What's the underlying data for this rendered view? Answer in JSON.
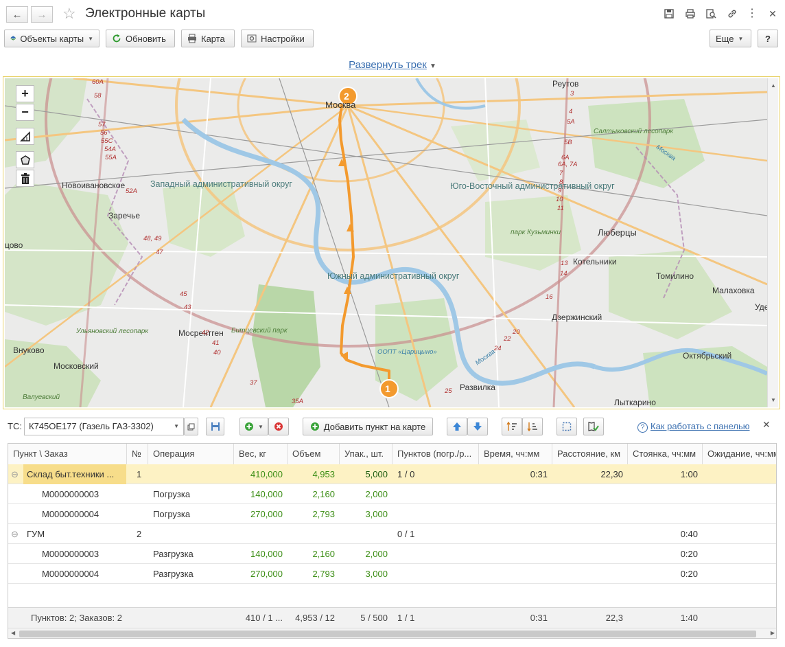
{
  "window": {
    "title": "Электронные карты",
    "back_icon": "←",
    "forward_icon": "→"
  },
  "toolbar": {
    "map_objects": "Объекты карты",
    "refresh": "Обновить",
    "map": "Карта",
    "settings": "Настройки",
    "more": "Еще",
    "help": "?"
  },
  "expand_track": "Развернуть трек",
  "map": {
    "zoom_in": "+",
    "zoom_out": "−",
    "markers": [
      "1",
      "2"
    ],
    "labels": {
      "moskva": "Москва",
      "reutov": "Реутов",
      "novoivanovskoe": "Новоивановское",
      "zarechye": "Заречье",
      "zapadny": "Западный административный округ",
      "yugo_vostochny": "Юго-Восточный административный округ",
      "yuzhny": "Южный административный округ",
      "lyubertsy": "Люберцы",
      "kotelniki": "Котельники",
      "tomilino": "Томилино",
      "malakhovka": "Малаховка",
      "dzerzhinsky": "Дзержинский",
      "mosrentgen": "Мосрентген",
      "vnukovo": "Внуково",
      "moskovsky": "Московский",
      "razvilka": "Развилка",
      "oktyabrsky": "Октябрьский",
      "lytkarino": "Лыткарино",
      "valuevsky": "Валуевский",
      "tsovo": "цово",
      "ude": "Уде",
      "saltykovsky": "Салтыковский лесопарк",
      "bitsevsky": "Битцевский парк",
      "kuzminki": "парк Кузьминки",
      "tsaritsyno": "ООПТ «Царицыно»",
      "ulyanovsky": "Ульяновский лесопарк",
      "moskva_river_1": "Москва",
      "moskva_river_2": "Москва"
    },
    "road_numbers_left": [
      "60A",
      "58",
      "57",
      "56",
      "55C",
      "54A",
      "55A",
      "52A",
      "48, 49",
      "47",
      "45",
      "43",
      "42",
      "41",
      "40",
      "37",
      "35A"
    ],
    "road_numbers_right": [
      "3",
      "4",
      "5A",
      "5B",
      "6A",
      "6A, 7A",
      "7",
      "8",
      "9",
      "10",
      "11",
      "13",
      "14",
      "16",
      "20",
      "22",
      "24",
      "25"
    ]
  },
  "panel": {
    "tc_label": "ТС:",
    "tc_value": "К745ОЕ177 (Газель ГАЗ-3302)",
    "add_point": "Добавить пункт на карте",
    "help_link": "Как работать с панелью",
    "close": "✕"
  },
  "table": {
    "columns": [
      "Пункт \\ Заказ",
      "№",
      "Операция",
      "Вес, кг",
      "Объем",
      "Упак., шт.",
      "Пунктов (погр./р...",
      "Время, чч:мм",
      "Расстояние, км",
      "Стоянка, чч:мм",
      "Ожидание, чч:мм"
    ],
    "rows": [
      {
        "point": "Склад быт.техники ...",
        "no": "1",
        "op": "",
        "weight": "410,000",
        "volume": "4,953",
        "pack": "5,000",
        "points": "1 / 0",
        "time": "0:31",
        "dist": "22,30",
        "stop": "1:00",
        "wait": "",
        "level": 0,
        "selected": true
      },
      {
        "point": "М0000000003",
        "no": "",
        "op": "Погрузка",
        "weight": "140,000",
        "volume": "2,160",
        "pack": "2,000",
        "points": "",
        "time": "",
        "dist": "",
        "stop": "",
        "wait": "",
        "level": 1,
        "selected": false
      },
      {
        "point": "М0000000004",
        "no": "",
        "op": "Погрузка",
        "weight": "270,000",
        "volume": "2,793",
        "pack": "3,000",
        "points": "",
        "time": "",
        "dist": "",
        "stop": "",
        "wait": "",
        "level": 1,
        "selected": false
      },
      {
        "point": "ГУМ",
        "no": "2",
        "op": "",
        "weight": "",
        "volume": "",
        "pack": "",
        "points": "0 / 1",
        "time": "",
        "dist": "",
        "stop": "0:40",
        "wait": "",
        "level": 0,
        "selected": false
      },
      {
        "point": "М0000000003",
        "no": "",
        "op": "Разгрузка",
        "weight": "140,000",
        "volume": "2,160",
        "pack": "2,000",
        "points": "",
        "time": "",
        "dist": "",
        "stop": "0:20",
        "wait": "",
        "level": 1,
        "selected": false
      },
      {
        "point": "М0000000004",
        "no": "",
        "op": "Разгрузка",
        "weight": "270,000",
        "volume": "2,793",
        "pack": "3,000",
        "points": "",
        "time": "",
        "dist": "",
        "stop": "0:20",
        "wait": "",
        "level": 1,
        "selected": false
      }
    ],
    "footer": {
      "point": "Пунктов: 2; Заказов: 2",
      "weight": "410 / 1 ...",
      "volume": "4,953 / 12",
      "pack": "5 / 500",
      "points": "1 / 1",
      "time": "0:31",
      "dist": "22,3",
      "stop": "1:40"
    }
  },
  "colors": {
    "accent_link": "#3a6fb0",
    "route": "#f5a03a",
    "selected_row": "#fdf2c4",
    "green_values": "#3b8d14"
  }
}
